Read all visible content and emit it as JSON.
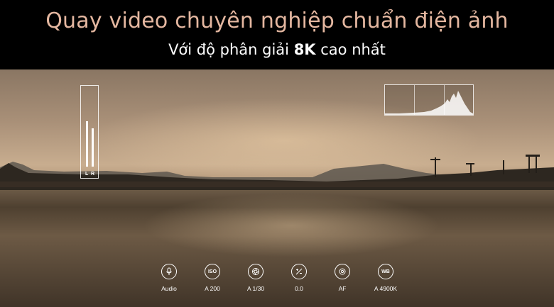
{
  "banner": {
    "headline": "Quay video chuyên nghiệp chuẩn điện ảnh",
    "subline_prefix": "Với độ phân giải ",
    "subline_emphasis": "8K",
    "subline_suffix": " cao nhất"
  },
  "audio_meter": {
    "left_label": "L",
    "right_label": "R"
  },
  "controls": [
    {
      "id": "audio",
      "icon": "microphone-icon",
      "label": "Audio"
    },
    {
      "id": "iso",
      "icon": "iso-icon",
      "icon_text": "ISO",
      "label": "A 200"
    },
    {
      "id": "shutter",
      "icon": "shutter-icon",
      "label": "A 1/30"
    },
    {
      "id": "exposure",
      "icon": "exposure-icon",
      "label": "0.0"
    },
    {
      "id": "focus",
      "icon": "focus-icon",
      "label": "AF"
    },
    {
      "id": "wb",
      "icon": "white-balance-icon",
      "icon_text": "WB",
      "label": "A 4900K"
    }
  ],
  "colors": {
    "headline": "#e4b7a0",
    "subline": "#ffffff",
    "overlay": "#ffffff"
  }
}
